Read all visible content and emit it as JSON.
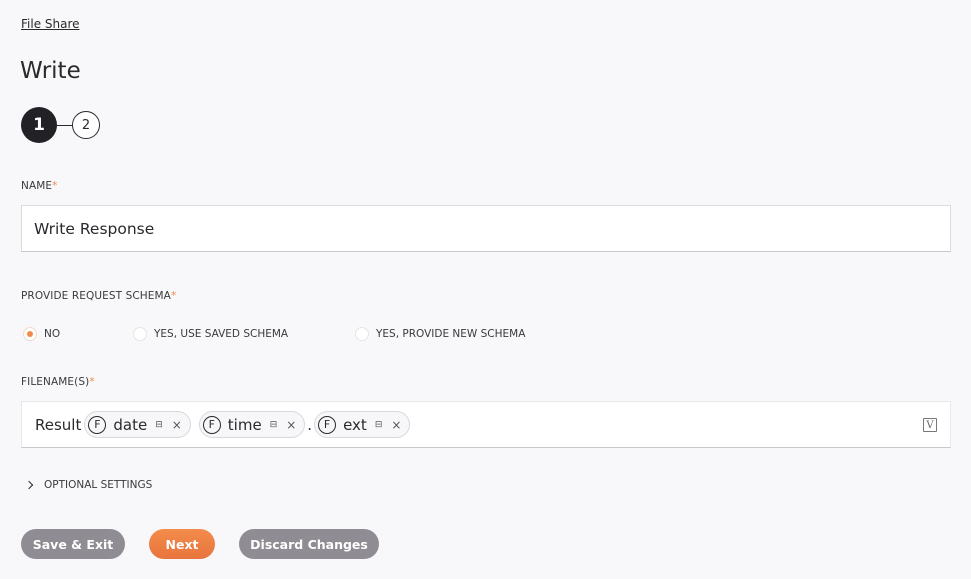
{
  "breadcrumb": "File Share",
  "page_title": "Write",
  "stepper": {
    "steps": [
      "1",
      "2"
    ],
    "active_step": 1
  },
  "name_field": {
    "label": "NAME",
    "required_mark": "*",
    "value": "Write Response"
  },
  "schema": {
    "label": "PROVIDE REQUEST SCHEMA",
    "required_mark": "*",
    "options": [
      "NO",
      "YES, USE SAVED SCHEMA",
      "YES, PROVIDE NEW SCHEMA"
    ],
    "selected": "NO"
  },
  "filenames": {
    "label": "FILENAME(S)",
    "required_mark": "*",
    "prefix_text": "Result",
    "separator": ".",
    "tags": [
      {
        "badge": "F",
        "name": "date",
        "mini_icon": "⊟",
        "remove": "×"
      },
      {
        "badge": "F",
        "name": "time",
        "mini_icon": "⊟",
        "remove": "×"
      },
      {
        "badge": "F",
        "name": "ext",
        "mini_icon": "⊟",
        "remove": "×"
      }
    ],
    "variable_icon": "V"
  },
  "optional_settings": "OPTIONAL SETTINGS",
  "buttons": {
    "save_exit": "Save & Exit",
    "next": "Next",
    "discard": "Discard Changes"
  },
  "colors": {
    "accent": "#f08a4b",
    "button_grey": "#8f8d93",
    "step_active": "#222126"
  }
}
